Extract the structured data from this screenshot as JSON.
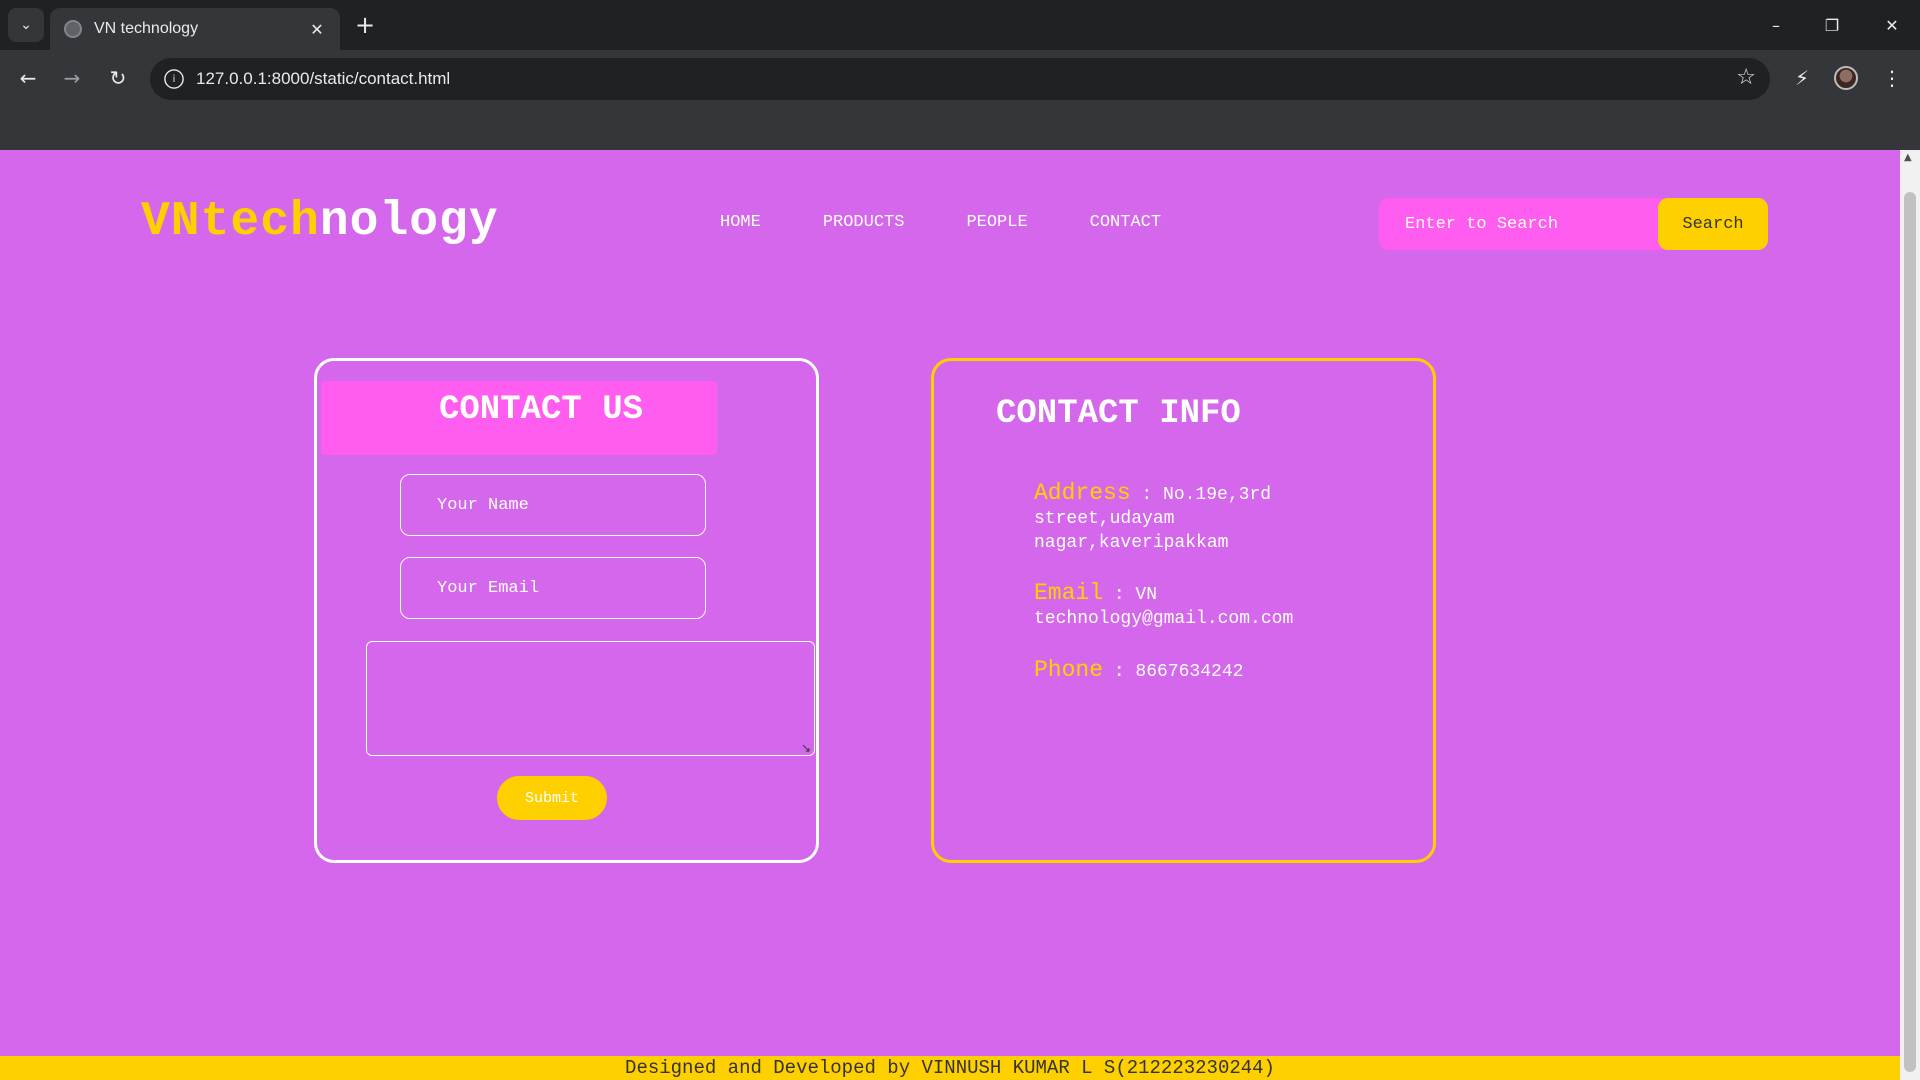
{
  "browser": {
    "tab_list_icon": "chevron-down-icon",
    "tab_title": "VN technology",
    "tab_close_icon": "close-icon",
    "new_tab_icon": "plus-icon",
    "url": "127.0.0.1:8000/static/contact.html",
    "back_icon": "arrow-left-icon",
    "forward_icon": "arrow-right-icon",
    "reload_icon": "reload-icon",
    "bookmark_icon": "star-icon",
    "extensions_icon": "extension-icon",
    "menu_icon": "kebab-menu-icon",
    "window_controls": [
      "minimize-icon",
      "restore-icon",
      "close-icon"
    ]
  },
  "site": {
    "logo": {
      "part1": "VN",
      "part2": "tech",
      "part3": "nology"
    },
    "nav": [
      "HOME",
      "PRODUCTS",
      "PEOPLE",
      "CONTACT"
    ],
    "search": {
      "placeholder": "Enter to Search",
      "button": "Search"
    },
    "contact_form": {
      "title": "CONTACT US",
      "name_placeholder": "Your Name",
      "email_placeholder": "Your Email",
      "message_value": "",
      "submit": "Submit"
    },
    "contact_info": {
      "title": "CONTACT INFO",
      "address_label": "Address",
      "address_value": "No.19e,3rd street,udayam nagar,kaveripakkam",
      "email_label": "Email",
      "email_value": "VN technology@gmail.com.com",
      "phone_label": "Phone",
      "phone_value": "8667634242",
      "separator": " : "
    },
    "footer": "Designed and Developed by VINNUSH KUMAR L S(212223230244)"
  },
  "colors": {
    "page_bg": "#d467eb",
    "accent_yellow": "#ffd000",
    "accent_pink": "#ff5cf0",
    "text_white": "#ffffff"
  }
}
